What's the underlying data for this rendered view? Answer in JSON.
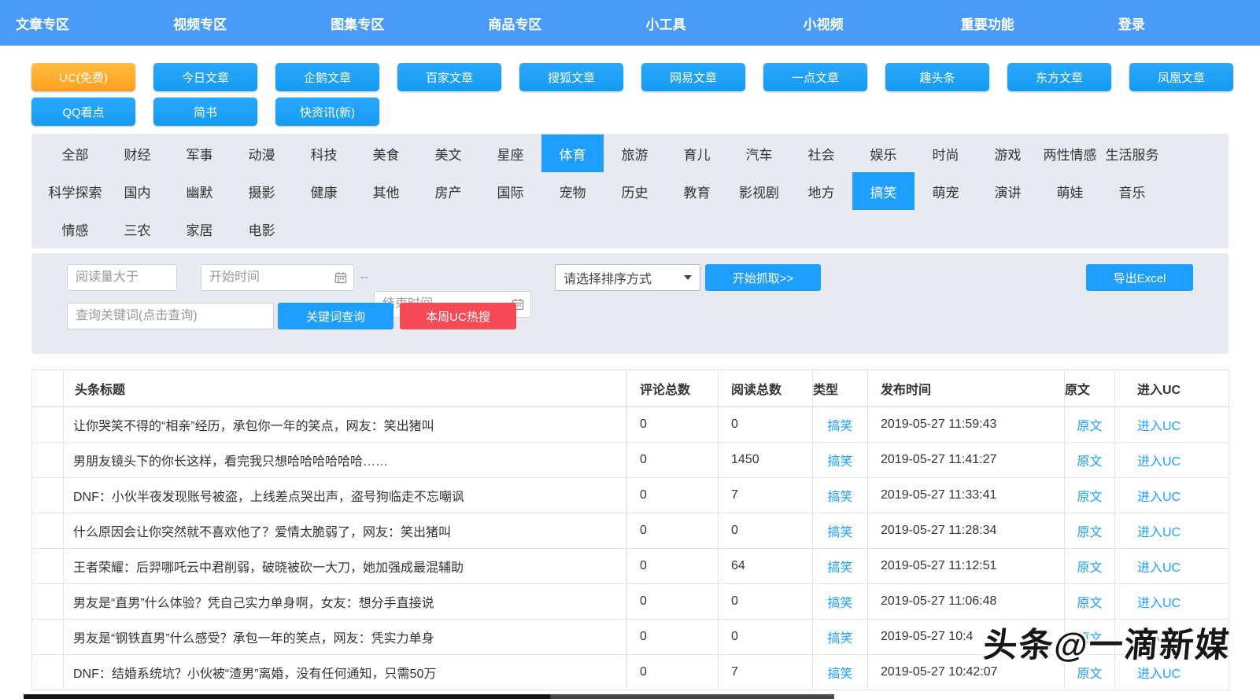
{
  "colors": {
    "nav_blue": "#4a9bf5",
    "accent_blue": "#1e9fff",
    "active_orange": "#ffad26",
    "danger_red": "#f54b55"
  },
  "nav": {
    "items": [
      "文章专区",
      "视频专区",
      "图集专区",
      "商品专区",
      "小工具",
      "小视频",
      "重要功能",
      "登录"
    ]
  },
  "sources": [
    {
      "t": "UC(免费)",
      "state": "active"
    },
    {
      "t": "今日文章"
    },
    {
      "t": "企鹅文章"
    },
    {
      "t": "百家文章"
    },
    {
      "t": "搜狐文章"
    },
    {
      "t": "网易文章"
    },
    {
      "t": "一点文章"
    },
    {
      "t": "趣头条"
    },
    {
      "t": "东方文章"
    },
    {
      "t": "凤凰文章"
    },
    {
      "t": "QQ看点"
    },
    {
      "t": "简书"
    },
    {
      "t": "快资讯(新)"
    }
  ],
  "categories": {
    "row1": [
      {
        "t": "全部"
      },
      {
        "t": "财经"
      },
      {
        "t": "军事"
      },
      {
        "t": "动漫"
      },
      {
        "t": "科技"
      },
      {
        "t": "美食"
      },
      {
        "t": "美文"
      },
      {
        "t": "星座"
      },
      {
        "t": "体育",
        "state": "selected"
      },
      {
        "t": "旅游"
      },
      {
        "t": "育儿"
      },
      {
        "t": "汽车"
      },
      {
        "t": "社会"
      },
      {
        "t": "娱乐"
      },
      {
        "t": "时尚"
      },
      {
        "t": "游戏"
      },
      {
        "t": "两性情感"
      },
      {
        "t": "生活服务"
      }
    ],
    "row2": [
      {
        "t": "科学探索"
      },
      {
        "t": "国内"
      },
      {
        "t": "幽默"
      },
      {
        "t": "摄影"
      },
      {
        "t": "健康"
      },
      {
        "t": "其他"
      },
      {
        "t": "房产"
      },
      {
        "t": "国际"
      },
      {
        "t": "宠物"
      },
      {
        "t": "历史"
      },
      {
        "t": "教育"
      },
      {
        "t": "影视剧"
      },
      {
        "t": "地方"
      },
      {
        "t": "搞笑",
        "state": "selected"
      },
      {
        "t": "萌宠"
      },
      {
        "t": "演讲"
      },
      {
        "t": "萌娃"
      },
      {
        "t": "音乐"
      }
    ],
    "row3": [
      {
        "t": "情感"
      },
      {
        "t": "三农"
      },
      {
        "t": "家居"
      },
      {
        "t": "电影"
      }
    ]
  },
  "filters": {
    "read_gt_placeholder": "阅读量大于",
    "start_placeholder": "开始时间",
    "range_sep": "--",
    "end_placeholder": "结束时间",
    "sort_select_value": "请选择排序方式",
    "grab_button": "开始抓取>>",
    "export_button": "导出Excel",
    "keyword_placeholder": "查询关键词(点击查询)",
    "keyword_button": "关键词查询",
    "hot_button": "本周UC热搜"
  },
  "table": {
    "headers": {
      "title": "头条标题",
      "comments": "评论总数",
      "reads": "阅读总数",
      "type": "类型",
      "time": "发布时间",
      "source": "原文",
      "uc": "进入UC"
    },
    "rows": [
      {
        "title": "让你哭笑不得的“相亲”经历，承包你一年的笑点，网友：笑出猪叫",
        "comments": "0",
        "reads": "0",
        "type": "搞笑",
        "time": "2019-05-27 11:59:43",
        "source": "原文",
        "uc": "进入UC"
      },
      {
        "title": "男朋友镜头下的你长这样，看完我只想哈哈哈哈哈哈……",
        "comments": "0",
        "reads": "1450",
        "type": "搞笑",
        "time": "2019-05-27 11:41:27",
        "source": "原文",
        "uc": "进入UC"
      },
      {
        "title": "DNF：小伙半夜发现账号被盗，上线差点哭出声，盗号狗临走不忘嘲讽",
        "comments": "0",
        "reads": "7",
        "type": "搞笑",
        "time": "2019-05-27 11:33:41",
        "source": "原文",
        "uc": "进入UC"
      },
      {
        "title": "什么原因会让你突然就不喜欢他了？爱情太脆弱了，网友：笑出猪叫",
        "comments": "0",
        "reads": "0",
        "type": "搞笑",
        "time": "2019-05-27 11:28:34",
        "source": "原文",
        "uc": "进入UC"
      },
      {
        "title": "王者荣耀：后羿哪吒云中君削弱，破晓被砍一大刀，她加强成最混辅助",
        "comments": "0",
        "reads": "64",
        "type": "搞笑",
        "time": "2019-05-27 11:12:51",
        "source": "原文",
        "uc": "进入UC"
      },
      {
        "title": "男友是“直男”什么体验？凭自己实力单身啊，女友：想分手直接说",
        "comments": "0",
        "reads": "0",
        "type": "搞笑",
        "time": "2019-05-27 11:06:48",
        "source": "原文",
        "uc": "进入UC"
      },
      {
        "title": "男友是“钢铁直男”什么感受？承包一年的笑点，网友：凭实力单身",
        "comments": "0",
        "reads": "0",
        "type": "搞笑",
        "time": "2019-05-27 10:4",
        "source": "原文",
        "uc": "进入UC"
      },
      {
        "title": "DNF：结婚系统坑？小伙被“渣男”离婚，没有任何通知，只需50万",
        "comments": "0",
        "reads": "7",
        "type": "搞笑",
        "time": "2019-05-27 10:42:07",
        "source": "原文",
        "uc": "进入UC"
      }
    ]
  },
  "watermark": "头条@一滴新媒"
}
